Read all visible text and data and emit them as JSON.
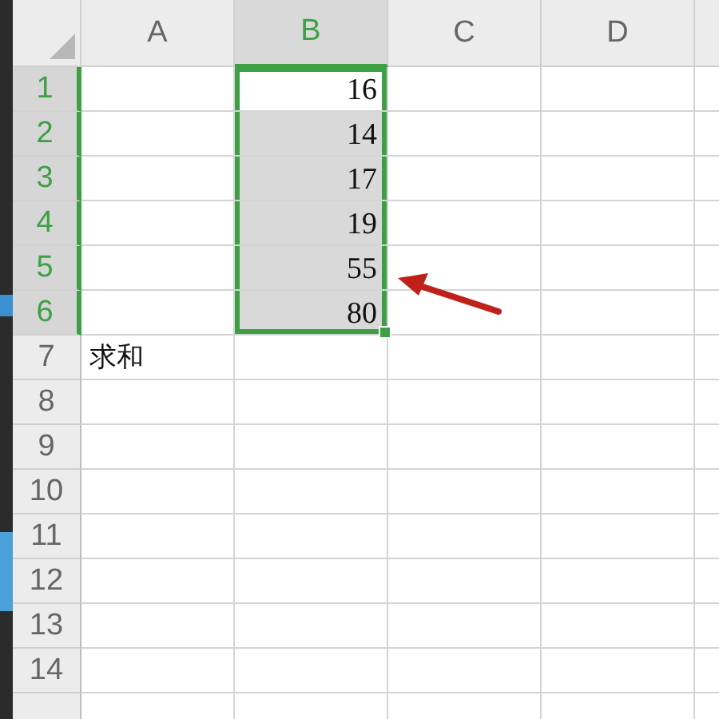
{
  "columns": [
    {
      "label": "A",
      "selected": false
    },
    {
      "label": "B",
      "selected": true
    },
    {
      "label": "C",
      "selected": false
    },
    {
      "label": "D",
      "selected": false
    }
  ],
  "rows": [
    {
      "label": "1",
      "selected": true,
      "cells": [
        {
          "selected": false
        },
        {
          "text": "16",
          "kind": "number",
          "selected": true,
          "active": true
        },
        {
          "selected": false
        },
        {
          "selected": false
        }
      ]
    },
    {
      "label": "2",
      "selected": true,
      "cells": [
        {
          "selected": false
        },
        {
          "text": "14",
          "kind": "number",
          "selected": true,
          "active": false
        },
        {
          "selected": false
        },
        {
          "selected": false
        }
      ]
    },
    {
      "label": "3",
      "selected": true,
      "cells": [
        {
          "selected": false
        },
        {
          "text": "17",
          "kind": "number",
          "selected": true,
          "active": false
        },
        {
          "selected": false
        },
        {
          "selected": false
        }
      ]
    },
    {
      "label": "4",
      "selected": true,
      "cells": [
        {
          "selected": false
        },
        {
          "text": "19",
          "kind": "number",
          "selected": true,
          "active": false
        },
        {
          "selected": false
        },
        {
          "selected": false
        }
      ]
    },
    {
      "label": "5",
      "selected": true,
      "cells": [
        {
          "selected": false
        },
        {
          "text": "55",
          "kind": "number",
          "selected": true,
          "active": false
        },
        {
          "selected": false
        },
        {
          "selected": false
        }
      ]
    },
    {
      "label": "6",
      "selected": true,
      "cells": [
        {
          "selected": false
        },
        {
          "text": "80",
          "kind": "number",
          "selected": true,
          "active": false
        },
        {
          "selected": false
        },
        {
          "selected": false
        }
      ]
    },
    {
      "label": "7",
      "selected": false,
      "cells": [
        {
          "text": "求和",
          "kind": "text",
          "selected": false
        },
        {
          "selected": false
        },
        {
          "selected": false
        },
        {
          "selected": false
        }
      ]
    },
    {
      "label": "8",
      "selected": false,
      "cells": [
        {
          "selected": false
        },
        {
          "selected": false
        },
        {
          "selected": false
        },
        {
          "selected": false
        }
      ]
    },
    {
      "label": "9",
      "selected": false,
      "cells": [
        {
          "selected": false
        },
        {
          "selected": false
        },
        {
          "selected": false
        },
        {
          "selected": false
        }
      ]
    },
    {
      "label": "10",
      "selected": false,
      "cells": [
        {
          "selected": false
        },
        {
          "selected": false
        },
        {
          "selected": false
        },
        {
          "selected": false
        }
      ]
    },
    {
      "label": "11",
      "selected": false,
      "cells": [
        {
          "selected": false
        },
        {
          "selected": false
        },
        {
          "selected": false
        },
        {
          "selected": false
        }
      ]
    },
    {
      "label": "12",
      "selected": false,
      "cells": [
        {
          "selected": false
        },
        {
          "selected": false
        },
        {
          "selected": false
        },
        {
          "selected": false
        }
      ]
    },
    {
      "label": "13",
      "selected": false,
      "cells": [
        {
          "selected": false
        },
        {
          "selected": false
        },
        {
          "selected": false
        },
        {
          "selected": false
        }
      ]
    },
    {
      "label": "14",
      "selected": false,
      "cells": [
        {
          "selected": false
        },
        {
          "selected": false
        },
        {
          "selected": false
        },
        {
          "selected": false
        }
      ]
    },
    {
      "selected": false,
      "cells": [
        {
          "selected": false
        },
        {
          "selected": false
        },
        {
          "selected": false
        },
        {
          "selected": false
        }
      ]
    }
  ],
  "callout": {
    "kind": "arrow"
  }
}
